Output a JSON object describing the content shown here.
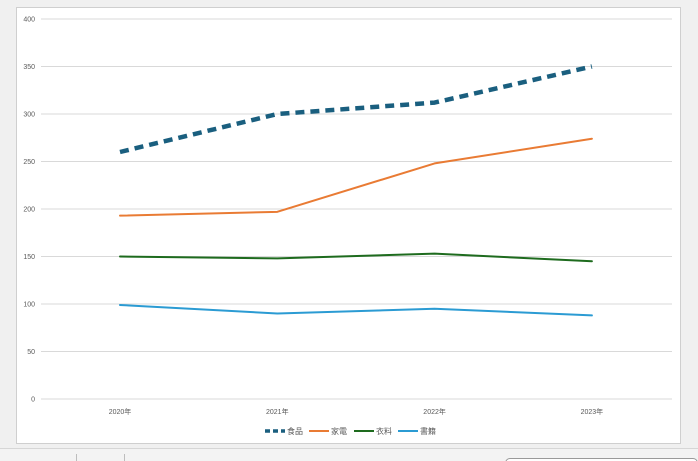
{
  "colors": {
    "food": "#1a5f7f",
    "appliances": "#e97b34",
    "clothing": "#1e6b1e",
    "books": "#2b9bd3",
    "grid": "#d9d9d9",
    "text": "#595959"
  },
  "chart_data": {
    "type": "line",
    "title": "",
    "xlabel": "",
    "ylabel": "",
    "categories": [
      "2020年",
      "2021年",
      "2022年",
      "2023年"
    ],
    "ylim": [
      0,
      400
    ],
    "yticks": [
      "0",
      "50",
      "100",
      "150",
      "200",
      "250",
      "300",
      "350",
      "400"
    ],
    "grid": true,
    "legend_position": "bottom",
    "series": [
      {
        "name": "食品",
        "values": [
          260,
          300,
          312,
          350
        ],
        "color": "#1a5f7f",
        "style": "dashed-thick"
      },
      {
        "name": "家電",
        "values": [
          193,
          197,
          248,
          274
        ],
        "color": "#e97b34",
        "style": "solid"
      },
      {
        "name": "衣料",
        "values": [
          150,
          148,
          153,
          145
        ],
        "color": "#1e6b1e",
        "style": "solid"
      },
      {
        "name": "書籍",
        "values": [
          99,
          90,
          95,
          88
        ],
        "color": "#2b9bd3",
        "style": "solid"
      }
    ]
  }
}
